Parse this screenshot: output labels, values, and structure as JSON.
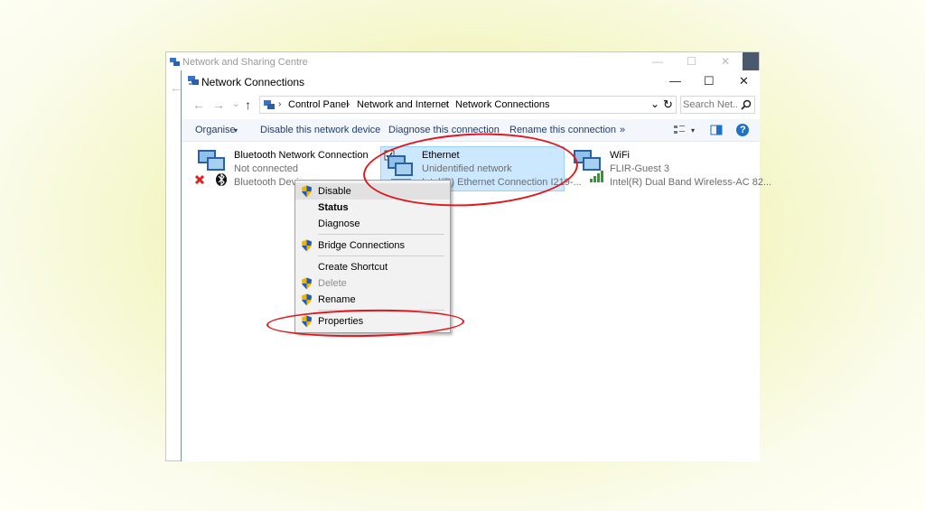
{
  "back_window": {
    "title": "Network and Sharing Centre",
    "controls": [
      "—",
      "☐",
      "✕"
    ]
  },
  "window": {
    "title": "Network Connections",
    "controls": [
      "—",
      "☐",
      "✕"
    ]
  },
  "address": {
    "nav": [
      "←",
      "→",
      "⌄",
      "↑"
    ],
    "crumbs": [
      "Control Panel",
      "Network and Internet",
      "Network Connections"
    ],
    "separator": "›",
    "dropdown": "⌄",
    "refresh": "↻",
    "search_placeholder": "Search Net...",
    "search_icon": "magnifier-icon"
  },
  "toolbar": {
    "organise": "Organise",
    "dropdown_caret": "▾",
    "disable": "Disable this network device",
    "diagnose": "Diagnose this connection",
    "rename": "Rename this connection",
    "more": "»",
    "help": "?"
  },
  "connections": [
    {
      "name": "Bluetooth Network Connection",
      "status": "Not connected",
      "device": "Bluetooth Devic"
    },
    {
      "name": "Ethernet",
      "status": "Unidentified network",
      "device": "Intel(R) Ethernet Connection I219-..."
    },
    {
      "name": "WiFi",
      "status": "FLIR-Guest  3",
      "device": "Intel(R) Dual Band Wireless-AC 82..."
    }
  ],
  "context_menu": {
    "disable": "Disable",
    "status": "Status",
    "diagnose": "Diagnose",
    "bridge": "Bridge Connections",
    "shortcut": "Create Shortcut",
    "delete": "Delete",
    "rename": "Rename",
    "properties": "Properties"
  },
  "colors": {
    "annotation": "#e2161c",
    "selection": "#cce8ff",
    "link": "#1e3e72"
  }
}
